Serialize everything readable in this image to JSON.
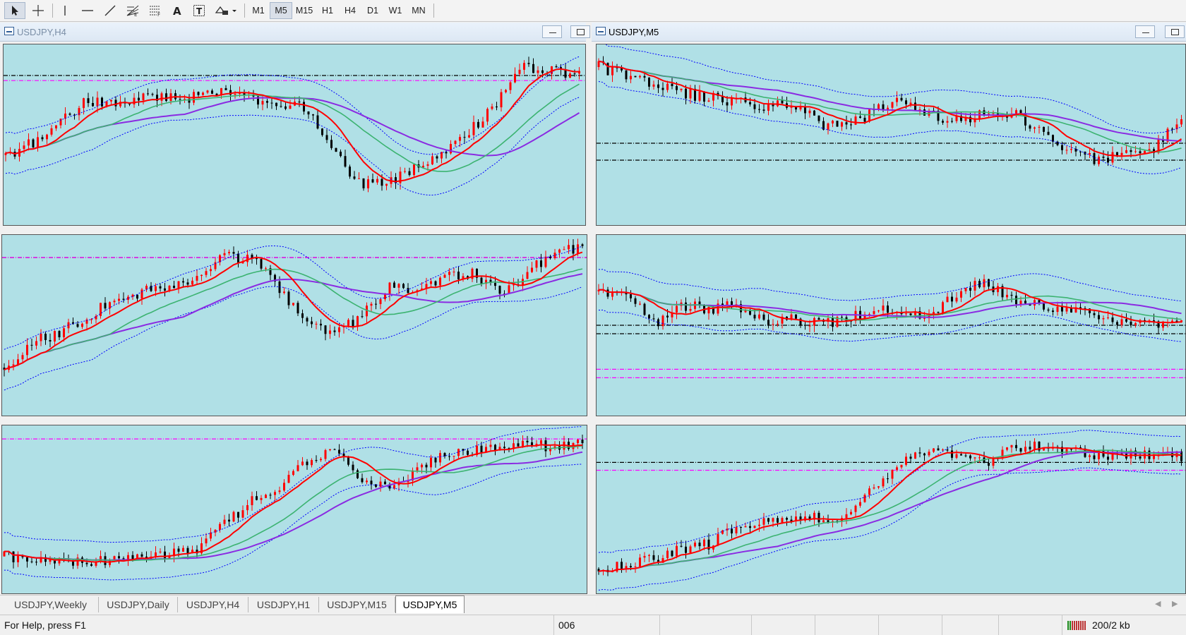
{
  "toolbar": {
    "timeframes": [
      "M1",
      "M5",
      "M15",
      "H1",
      "H4",
      "D1",
      "W1",
      "MN"
    ],
    "active_timeframe": "M5",
    "tools": [
      "cursor-icon",
      "crosshair-icon",
      "vertical-line-icon",
      "horizontal-line-icon",
      "trendline-icon",
      "fibonacci-fan-icon",
      "fibonacci-retracement-icon",
      "text-icon",
      "text-label-icon",
      "shapes-dropdown-icon"
    ]
  },
  "windows": [
    {
      "title": "USDJPY,H4",
      "title_visible": true,
      "title_color": "#7a8ea6"
    },
    {
      "title": "USDJPY,M5",
      "title_visible": true,
      "title_color": "#000000"
    },
    {
      "title": "",
      "title_visible": false
    },
    {
      "title": "",
      "title_visible": false
    },
    {
      "title": "",
      "title_visible": false
    },
    {
      "title": "",
      "title_visible": false
    }
  ],
  "tabs": [
    "USDJPY,Weekly",
    "USDJPY,Daily",
    "USDJPY,H4",
    "USDJPY,H1",
    "USDJPY,M15",
    "USDJPY,M5"
  ],
  "active_tab": "USDJPY,M5",
  "status": {
    "help": "For Help, press F1",
    "profile": "006",
    "traffic": "200/2 kb"
  },
  "colors": {
    "chart_bg": "#b0e0e6",
    "bull_candle": "#ff0000",
    "bear_candle": "#000000",
    "ma_fast": "#ff0000",
    "ma_mid": "#3cb371",
    "ma_slow": "#8a2be2",
    "bands": "#0000ff",
    "level_black": "#000000",
    "level_magenta": "#ff00ff"
  }
}
